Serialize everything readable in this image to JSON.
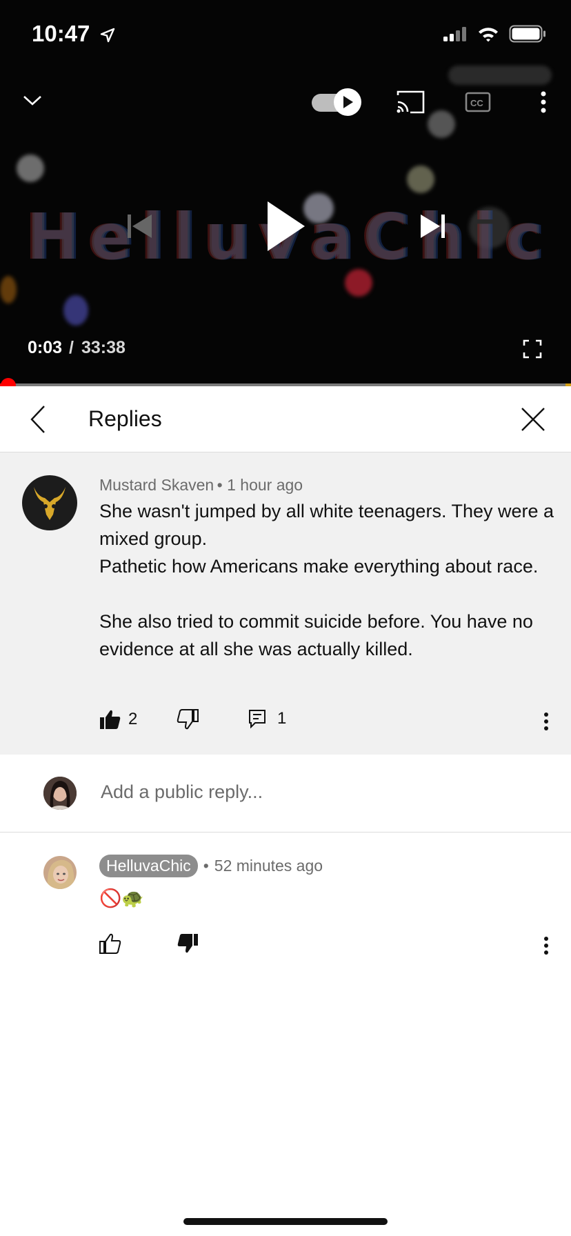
{
  "status_bar": {
    "time": "10:47"
  },
  "player": {
    "title_art": "HelluvaChic",
    "time_current": "0:03",
    "time_separator": "/",
    "time_total": "33:38",
    "progress": 0.0015,
    "autoplay_on": true
  },
  "replies_panel": {
    "title": "Replies"
  },
  "parent_comment": {
    "author": "Mustard Skaven",
    "time_ago": "1 hour ago",
    "text": "She wasn't jumped by all white teenagers. They were a mixed group.\nPathetic how Americans make everything about race.\n\nShe also tried to commit suicide before. You have no evidence at all she was actually killed.",
    "like_count": "2",
    "reply_count": "1"
  },
  "reply_box": {
    "placeholder": "Add a public reply..."
  },
  "reply": {
    "author": "HelluvaChic",
    "time_ago": "52 minutes ago",
    "text": "🚫🐢"
  },
  "colors": {
    "accent": "#ff0000",
    "chip": "#8d8d8d",
    "comment_bg": "#f1f1f1"
  }
}
